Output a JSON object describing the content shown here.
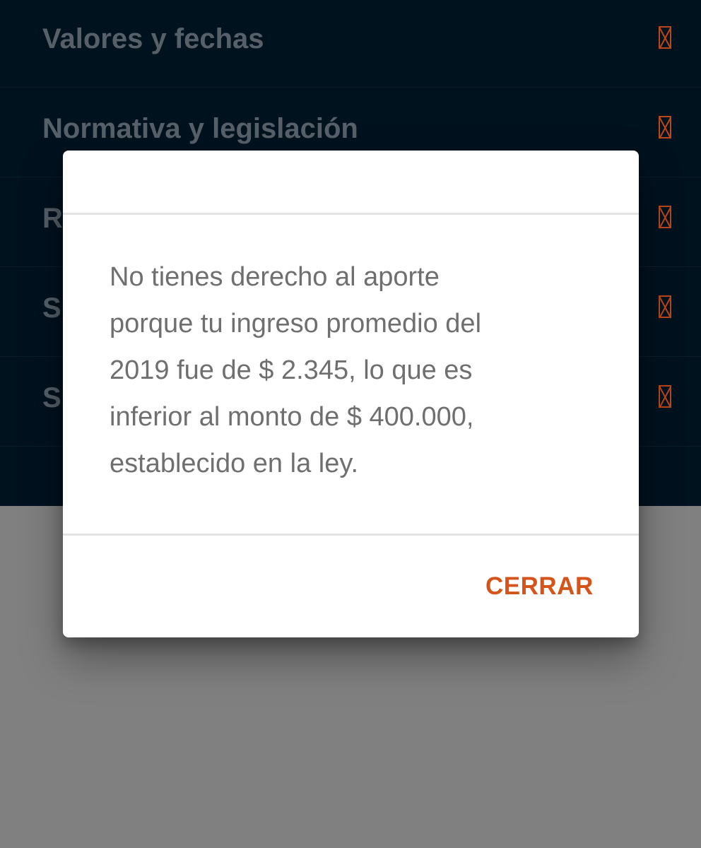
{
  "menu": {
    "items": [
      {
        "label": "Valores y fechas",
        "icon": "broken-glyph-icon"
      },
      {
        "label": "Normativa y legislación",
        "icon": "broken-glyph-icon"
      },
      {
        "label": "R",
        "icon": "broken-glyph-icon"
      },
      {
        "label": "S",
        "icon": "broken-glyph-icon"
      },
      {
        "label": "S",
        "icon": "broken-glyph-icon"
      }
    ]
  },
  "dialog": {
    "lines": [
      "No tienes derecho al aporte",
      "porque tu ingreso promedio del",
      "2019 fue de $ 2.345, lo que es",
      "inferior al monto de $ 400.000,",
      "establecido en la ley."
    ],
    "close_label": "CERRAR"
  },
  "colors": {
    "menu_background": "#01121f",
    "accent": "#d4541a",
    "backdrop": "#808080",
    "dialog_text": "#6f6f6f"
  }
}
